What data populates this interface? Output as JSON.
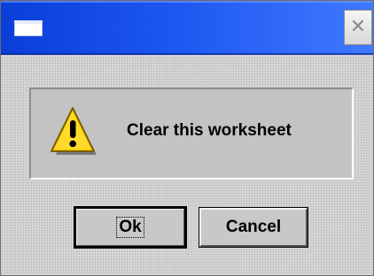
{
  "window": {
    "title": "",
    "icon": "window-icon",
    "close_label": "✕",
    "close_icon": "close-icon"
  },
  "message": {
    "icon": "warning-icon",
    "text": "Clear this worksheet"
  },
  "buttons": {
    "ok_label": "Ok",
    "cancel_label": "Cancel"
  },
  "colors": {
    "title_bar": "#1d56f0",
    "dialog_bg": "#d4d4d4",
    "panel_bg": "#c3c3c3",
    "warning_fill": "#ffd200"
  }
}
